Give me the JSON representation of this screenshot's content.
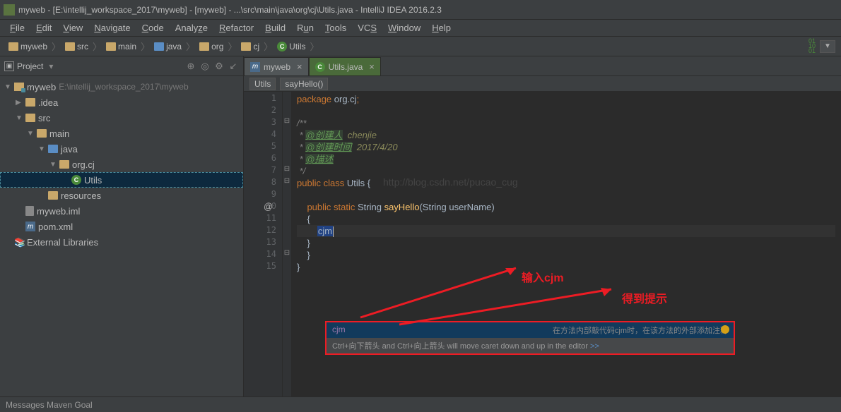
{
  "titlebar": {
    "text": "myweb - [E:\\intellij_workspace_2017\\myweb] - [myweb] - ...\\src\\main\\java\\org\\cj\\Utils.java - IntelliJ IDEA 2016.2.3"
  },
  "menubar": {
    "items": [
      "File",
      "Edit",
      "View",
      "Navigate",
      "Code",
      "Analyze",
      "Refactor",
      "Build",
      "Run",
      "Tools",
      "VCS",
      "Window",
      "Help"
    ]
  },
  "breadcrumbs": {
    "items": [
      "myweb",
      "src",
      "main",
      "java",
      "org",
      "cj",
      "Utils"
    ]
  },
  "project": {
    "title": "Project",
    "root": {
      "name": "myweb",
      "path": "E:\\intellij_workspace_2017\\myweb"
    },
    "idea": ".idea",
    "src": "src",
    "main": "main",
    "java": "java",
    "pkg": "org.cj",
    "utils": "Utils",
    "resources": "resources",
    "iml": "myweb.iml",
    "pom": "pom.xml",
    "ext": "External Libraries"
  },
  "tabs": {
    "t1": "myweb",
    "t2": "Utils.java"
  },
  "navcrumb": {
    "c1": "Utils",
    "c2": "sayHello()"
  },
  "code": {
    "l1_kw": "package",
    "l1_pkg": " org.cj",
    "l1_semi": ";",
    "l3": "/**",
    "l4_star": " * ",
    "l4_tag": "@创建人",
    "l4_val": "  chenjie",
    "l5_star": " * ",
    "l5_tag": "@创建时间",
    "l5_val": "  2017/4/20",
    "l6_star": " * ",
    "l6_tag": "@描述",
    "l7": " */",
    "l8_pub": "public",
    "l8_cls": " class ",
    "l8_name": "Utils",
    "l8_brace": " {",
    "l10_pub": "public",
    "l10_static": " static ",
    "l10_ret": "String ",
    "l10_method": "sayHello",
    "l10_paren": "(",
    "l10_ptype": "String",
    "l10_pname": " userName",
    "l10_close": ")",
    "l11": "{",
    "l12_typed": "cjm",
    "l13": "}",
    "l14": "}",
    "l15": "}",
    "watermark": "http://blog.csdn.net/pucao_cug"
  },
  "completion": {
    "item": "cjm",
    "desc": "在方法内部敲代码cjm时，在该方法的外部添加注释",
    "tip": "Ctrl+向下箭头 and Ctrl+向上箭头 will move caret down and up in the editor ",
    "tiplink": ">>"
  },
  "annotations": {
    "a1": "输入cjm",
    "a2": "得到提示"
  },
  "statusbar": {
    "text": "Messages Maven Goal"
  }
}
